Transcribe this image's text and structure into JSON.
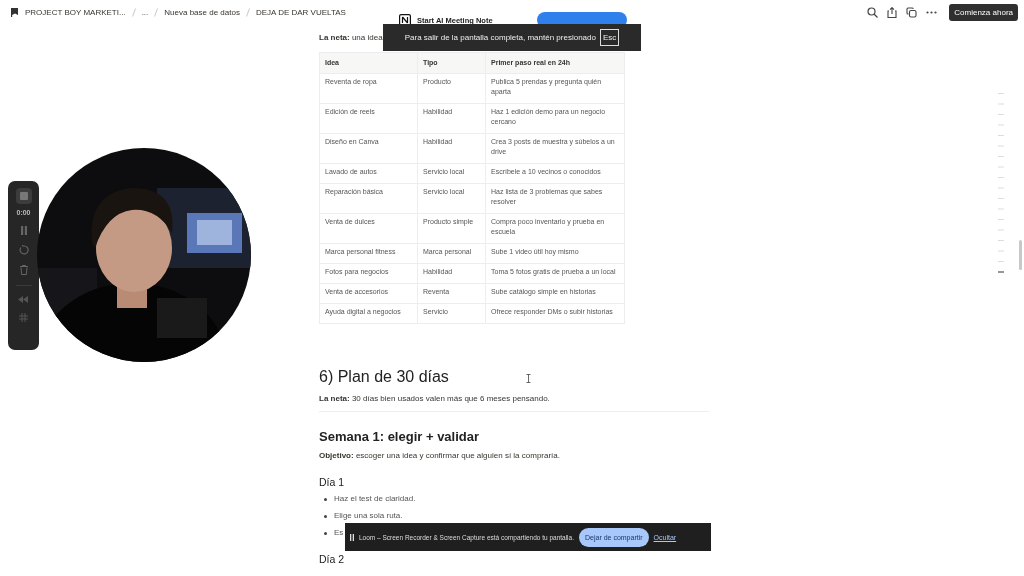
{
  "breadcrumbs": [
    {
      "label": "PROJECT BOY MARKETI..."
    },
    {
      "label": "..."
    },
    {
      "label": "Nueva base de datos"
    },
    {
      "label": "DEJA DE DAR VUELTAS"
    }
  ],
  "top_actions": {
    "button": "Comienza ahora"
  },
  "meeting_popup": {
    "title": "Start AI Meeting Note"
  },
  "fullscreen_notice": {
    "text": "Para salir de la pantalla completa, mantén presionado",
    "key": "Esc"
  },
  "intro": "**La neta:** una idea",
  "table": {
    "columns": [
      "Idea",
      "Tipo",
      "Primer paso real en 24h"
    ],
    "rows": [
      [
        "Reventa de ropa",
        "Producto",
        "Publica 5 prendas y pregunta quién aparta"
      ],
      [
        "Edición de reels",
        "Habilidad",
        "Haz 1 edición demo para un negocio cercano"
      ],
      [
        "Diseño en Canva",
        "Habilidad",
        "Crea 3 posts de muestra y súbelos a un drive"
      ],
      [
        "Lavado de autos",
        "Servicio local",
        "Escríbele a 10 vecinos o conocidos"
      ],
      [
        "Reparación básica",
        "Servicio local",
        "Haz lista de 3 problemas que sabes resolver"
      ],
      [
        "Venta de dulces",
        "Producto simple",
        "Compra poco inventario y prueba en escuela"
      ],
      [
        "Marca personal fitness",
        "Marca personal",
        "Sube 1 video útil hoy mismo"
      ],
      [
        "Fotos para negocios",
        "Habilidad",
        "Toma 5 fotos gratis de prueba a un local"
      ],
      [
        "Venta de accesorios",
        "Reventa",
        "Sube catálogo simple en historias"
      ],
      [
        "Ayuda digital a negocios",
        "Servicio",
        "Ofrece responder DMs o subir historias"
      ]
    ]
  },
  "plan": {
    "heading": "6) Plan de 30 días",
    "summary": "**La neta:** 30 días bien usados valen más que 6 meses pensando."
  },
  "week": {
    "heading": "Semana 1: elegir + validar",
    "goal": "**Objetivo:** escoger una idea y confirmar que alguien sí la compraría."
  },
  "days": [
    {
      "heading": "Día 1",
      "items": [
        "Haz el test de claridad.",
        "Elige una sola ruta.",
        "Es"
      ]
    },
    {
      "heading": "Día 2"
    }
  ],
  "loom_controls": {
    "time": "0:00"
  },
  "share_bar": {
    "text": "Loom – Screen Recorder & Screen Capture está compartiendo tu pantalla.",
    "stop_button": "Dejar de compartir",
    "hide_link": "Ocultar"
  }
}
